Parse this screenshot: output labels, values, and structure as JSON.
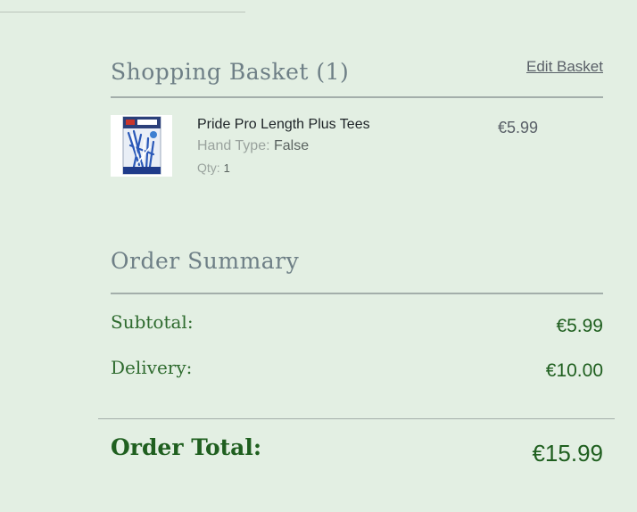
{
  "basket": {
    "title": "Shopping Basket (1)",
    "edit_label": "Edit Basket",
    "items": [
      {
        "name": "Pride Pro Length Plus Tees",
        "hand_type_label": "Hand Type:",
        "hand_type_value": "False",
        "qty_label": "Qty:",
        "qty_value": "1",
        "price": "€5.99"
      }
    ]
  },
  "summary": {
    "title": "Order Summary",
    "subtotal_label": "Subtotal:",
    "subtotal_value": "€5.99",
    "delivery_label": "Delivery:",
    "delivery_value": "€10.00",
    "total_label": "Order Total:",
    "total_value": "€15.99"
  },
  "colors": {
    "background": "#e3efe3",
    "heading": "#6e7f86",
    "summary_text": "#1f5f1f"
  },
  "icons": {
    "product_image": "golf-tees-package"
  }
}
